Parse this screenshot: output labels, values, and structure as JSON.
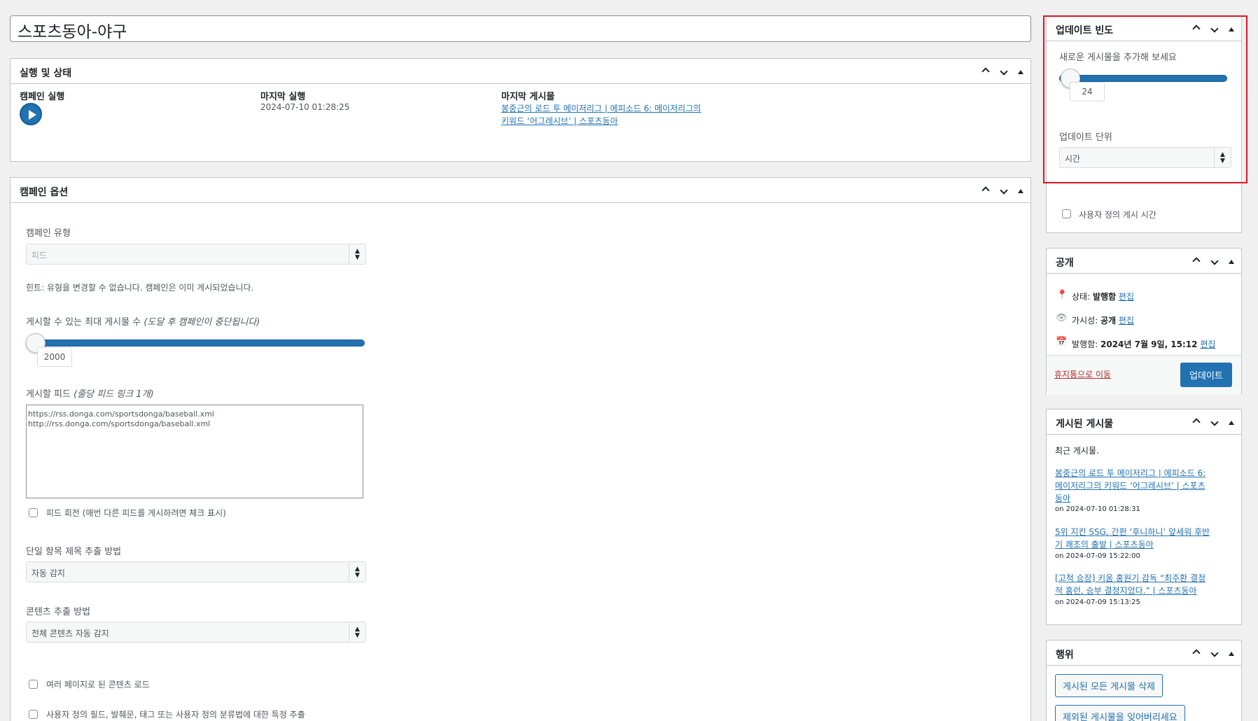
{
  "post_title": "스포츠동아-야구",
  "status_box": {
    "title": "실행 및 상태",
    "run_label": "캠페인 실행",
    "last_run_label": "마지막 실행",
    "last_run_value": "2024-07-10 01:28:25",
    "last_post_label": "마지막 게시물",
    "last_post_line1": "봉중근의 로드 투 메이저리그 | 에피소드 6: 메이저리그의",
    "last_post_line2": "키워드 ‘어그레시브’ | 스포츠동아"
  },
  "options_box": {
    "title": "캠페인 옵션",
    "campaign_type_label": "캠페인 유형",
    "campaign_type_value": "피드",
    "hint": "힌트: 유형을 변경할 수 없습니다. 캠페인은 이미 게시되었습니다.",
    "max_posts_label": "게시할 수 있는 최대 게시물 수",
    "max_posts_note": "(도달 후 캠페인이 중단됩니다)",
    "max_posts_value": "2000",
    "feeds_label": "게시할 피드",
    "feeds_note": "(줄당 피드 링크 1개)",
    "feeds_text": "https://rss.donga.com/sportsdonga/baseball.xml\nhttp://rss.donga.com/sportsdonga/baseball.xml",
    "feed_rotate_label": "피드 회전 (매번 다른 피드를 게시하려면 체크 표시)",
    "title_extract_label": "단일 항목 제목 추출 방법",
    "title_extract_value": "자동 감지",
    "content_extract_label": "콘텐츠 추출 방법",
    "content_extract_value": "전체 콘텐츠 자동 감지",
    "multipage_label": "여러 페이지로 된 콘텐츠 로드",
    "custom_fields_label": "사용자 정의 필드, 발췌문, 태그 또는 사용자 정의 분류법에 대한 특정 추출"
  },
  "frequency_box": {
    "title": "업데이트 빈도",
    "add_posts_label": "새로운 게시물을 추가해 보세요",
    "slider_value": "24",
    "unit_label": "업데이트 단위",
    "unit_value": "시간",
    "custom_time_label": "사용자 정의 게시 시간"
  },
  "publish_box": {
    "title": "공개",
    "status_label": "상태:",
    "status_value": "발행함",
    "visibility_label": "가시성:",
    "visibility_value": "공개",
    "published_label": "발행함:",
    "published_value": "2024년 7월 9일, 15:12",
    "edit": "편집",
    "trash": "휴지통으로 이동",
    "update_button": "업데이트"
  },
  "posted_box": {
    "title": "게시된 게시물",
    "recent": "최근 게시물.",
    "items": [
      {
        "l1": "봉중근의 로드 투 메이저리그 | 에피소드 6:",
        "l2": "메이저리그의 키워드 ‘어그레시브’ | 스포츠",
        "l3": "동아",
        "date": "on 2024-07-10 01:28:31"
      },
      {
        "l1": "5위 지킨 SSG, 간판 ‘후니하니’ 앞세워 후반",
        "l2": "기 쾌조의 출발 | 스포츠동아",
        "l3": "",
        "date": "on 2024-07-09 15:22:00"
      },
      {
        "l1": "[고척 승장] 키움 홍원기 감독 “최주환 결정",
        "l2": "적 홈런, 승부 결정지었다.” | 스포츠동아",
        "l3": "",
        "date": "on 2024-07-09 15:13:25"
      }
    ]
  },
  "actions_box": {
    "title": "행위",
    "delete_all": "게시된 모든 게시물 삭제",
    "forget_excluded": "제외된 게시물을 잊어버리세요"
  },
  "highlight_color": "#e0141e",
  "accent_color": "#2271b1"
}
